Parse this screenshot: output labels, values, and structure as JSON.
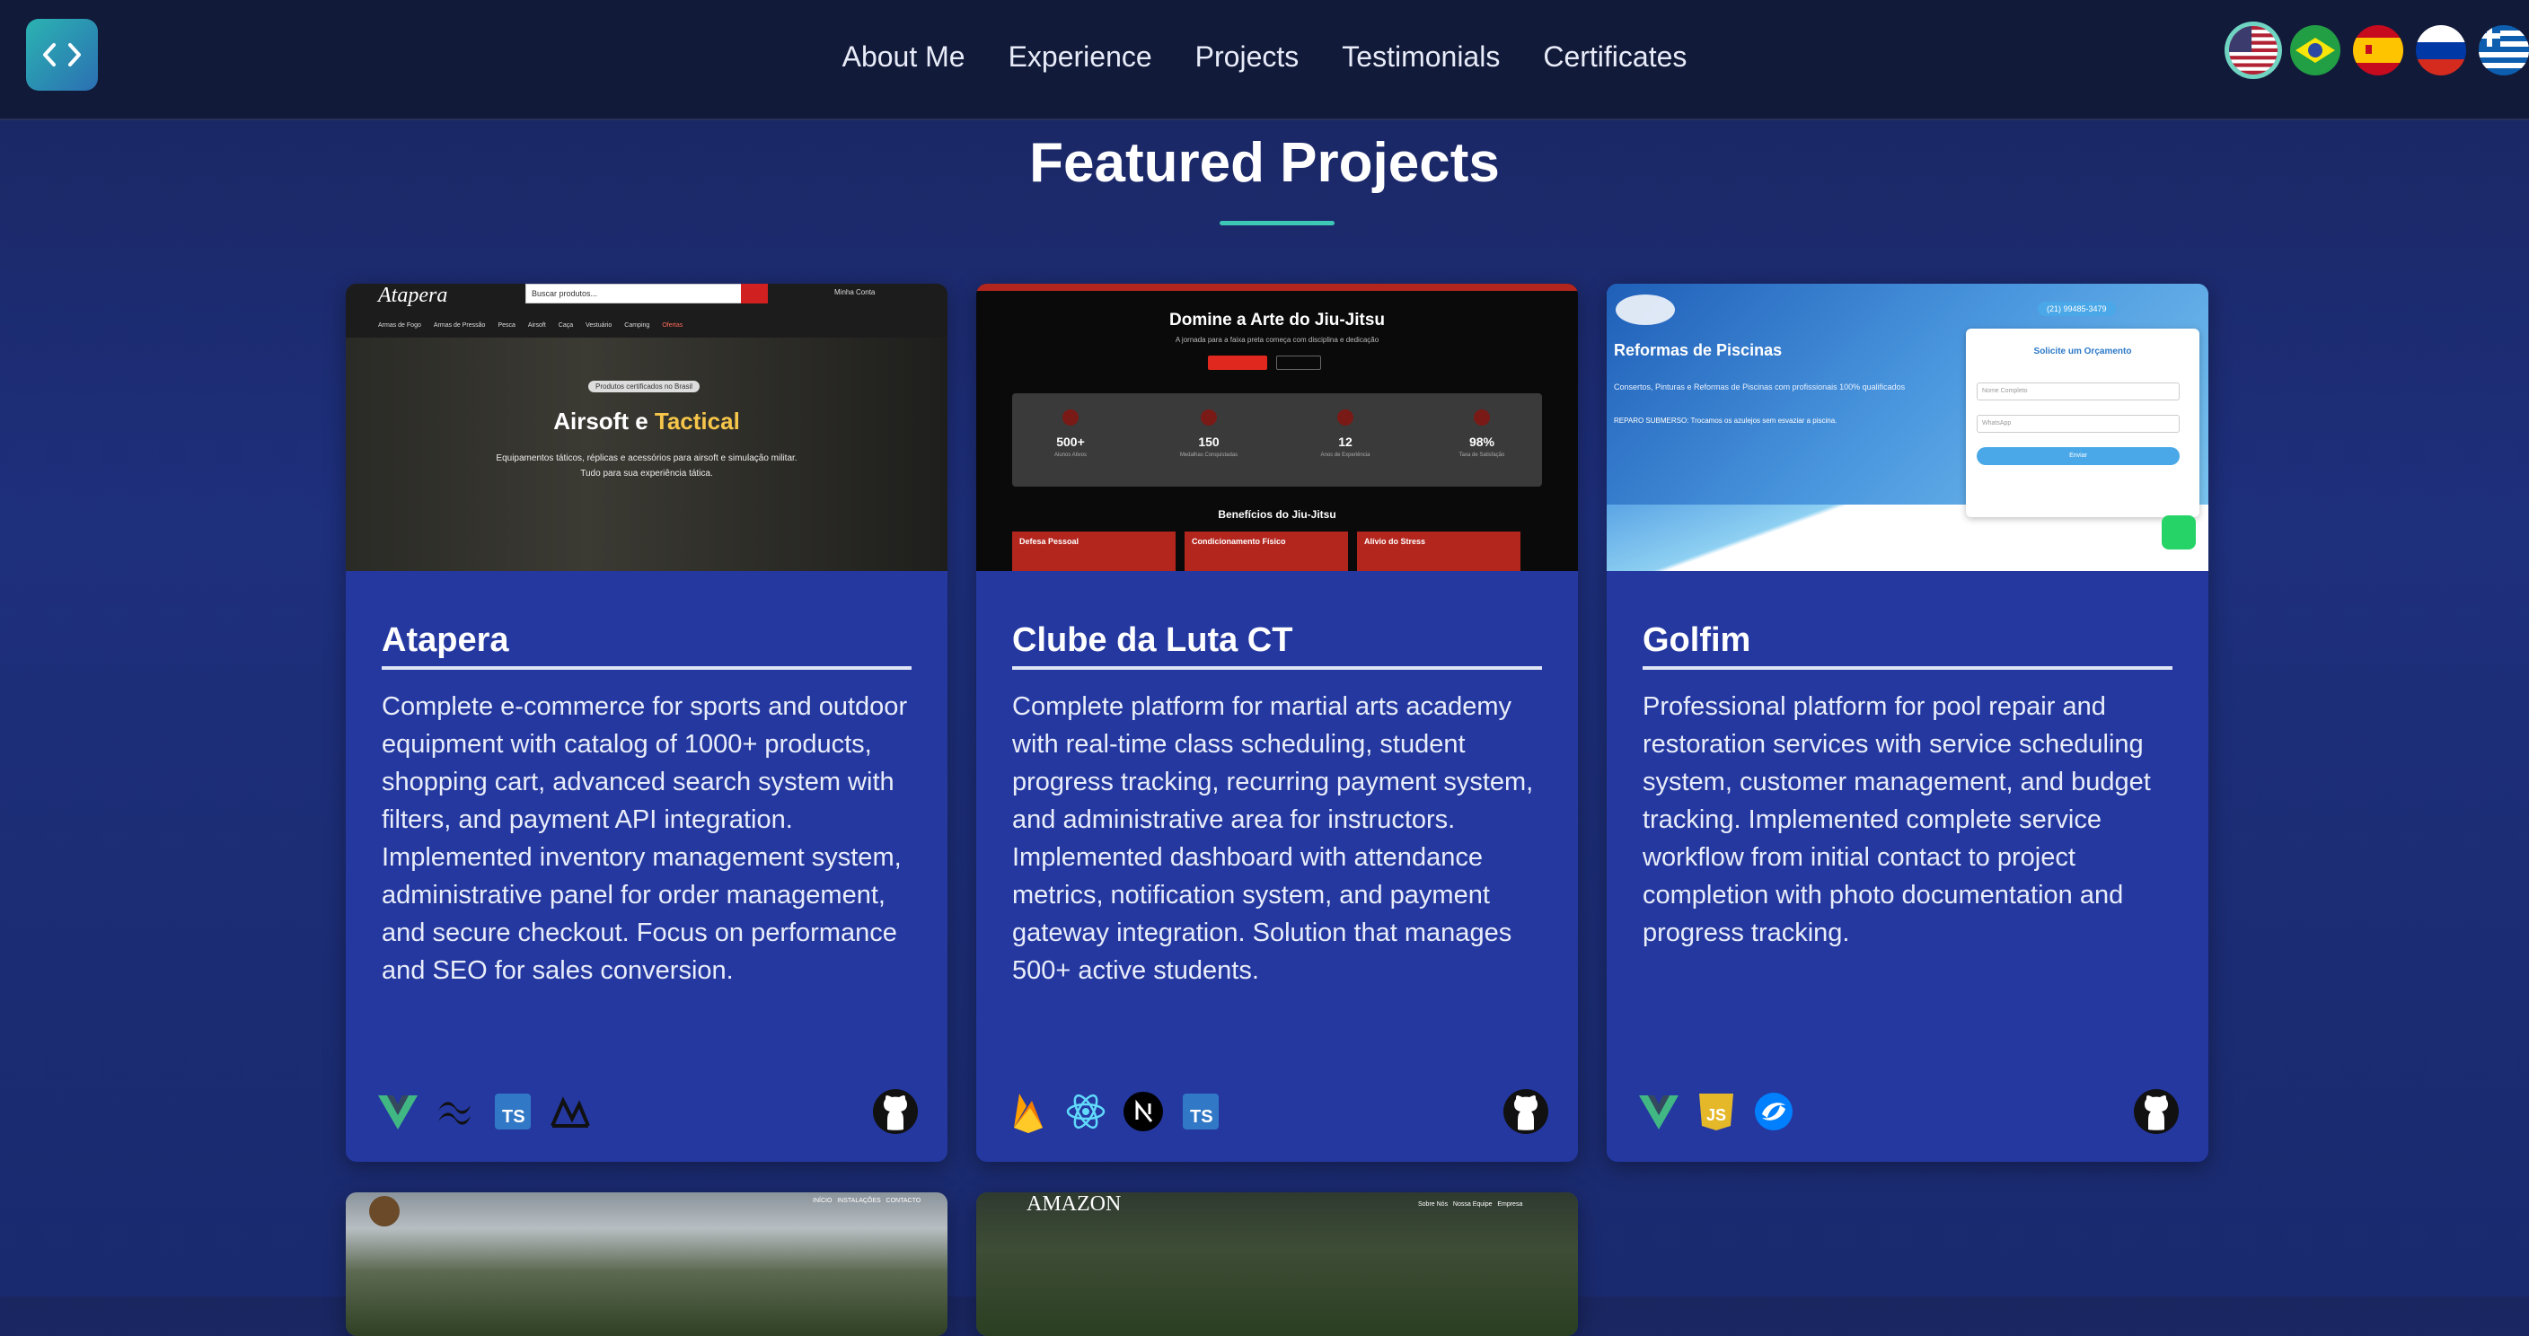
{
  "nav": {
    "links": [
      "About Me",
      "Experience",
      "Projects",
      "Testimonials",
      "Certificates"
    ]
  },
  "languages": [
    "us",
    "br",
    "es",
    "ru",
    "gr"
  ],
  "section": {
    "title": "Featured Projects"
  },
  "projects": [
    {
      "title": "Atapera",
      "description": "Complete e-commerce for sports and outdoor equipment with catalog of 1000+ products, shopping cart, advanced search system with filters, and payment API integration. Implemented inventory management system, administrative panel for order management, and secure checkout. Focus on performance and SEO for sales conversion.",
      "tech": [
        "vue-icon",
        "tailwind-icon",
        "typescript-icon",
        "mui-icon"
      ],
      "thumb": {
        "brand": "Atapera",
        "search": "Buscar produtos...",
        "account": "Minha Conta",
        "menu": [
          "Armas de Fogo",
          "Armas de Pressão",
          "Pesca",
          "Airsoft",
          "Caça",
          "Vestuário",
          "Camping",
          "Ofertas"
        ],
        "badge": "Produtos certificados no Brasil",
        "hero_a": "Airsoft e ",
        "hero_b": "Tactical",
        "hero_sub": "Equipamentos táticos, réplicas e acessórios para airsoft e simulação militar. Tudo para sua experiência tática."
      }
    },
    {
      "title": "Clube da Luta CT",
      "description": "Complete platform for martial arts academy with real-time class scheduling, student progress tracking, recurring payment system, and administrative area for instructors. Implemented dashboard with attendance metrics, notification system, and payment gateway integration. Solution that manages 500+ active students.",
      "tech": [
        "firebase-icon",
        "react-icon",
        "nextjs-icon",
        "typescript-icon"
      ],
      "thumb": {
        "heading": "Domine a Arte do Jiu-Jitsu",
        "sub": "A jornada para a faixa preta começa com disciplina e dedicação",
        "stats": [
          "500+",
          "150",
          "12",
          "98%"
        ],
        "stat_labels": [
          "Alunos Ativos",
          "Medalhas Conquistadas",
          "Anos de Experiência",
          "Taxa de Satisfação"
        ],
        "benefits": "Benefícios do Jiu-Jitsu",
        "cards": [
          "Defesa Pessoal",
          "Condicionamento Físico",
          "Alívio do Stress"
        ]
      }
    },
    {
      "title": "Golfim",
      "description": "Professional platform for pool repair and restoration services with service scheduling system, customer management, and budget tracking. Implemented complete service workflow from initial contact to project completion with photo documentation and progress tracking.",
      "tech": [
        "vue-icon",
        "javascript-icon",
        "swiper-icon"
      ],
      "thumb": {
        "phone": "(21) 99485-3479",
        "heading": "Reformas de Piscinas",
        "sub": "Consertos, Pinturas e Reformas de Piscinas com profissionais 100% qualificados",
        "note": "REPARO SUBMERSO: Trocamos os azulejos sem esvaziar a piscina.",
        "form_title": "Solicite um Orçamento",
        "field_name": "Nome Completo",
        "field_whats": "WhatsApp",
        "form_button": "Enviar"
      }
    }
  ],
  "partial_cards": [
    {
      "nav": "INÍCIO   INSTALAÇÕES   CONTACTO"
    },
    {
      "brand": "AMAZON",
      "nav": "Sobre Nós   Nossa Equipe   Empresa"
    }
  ]
}
